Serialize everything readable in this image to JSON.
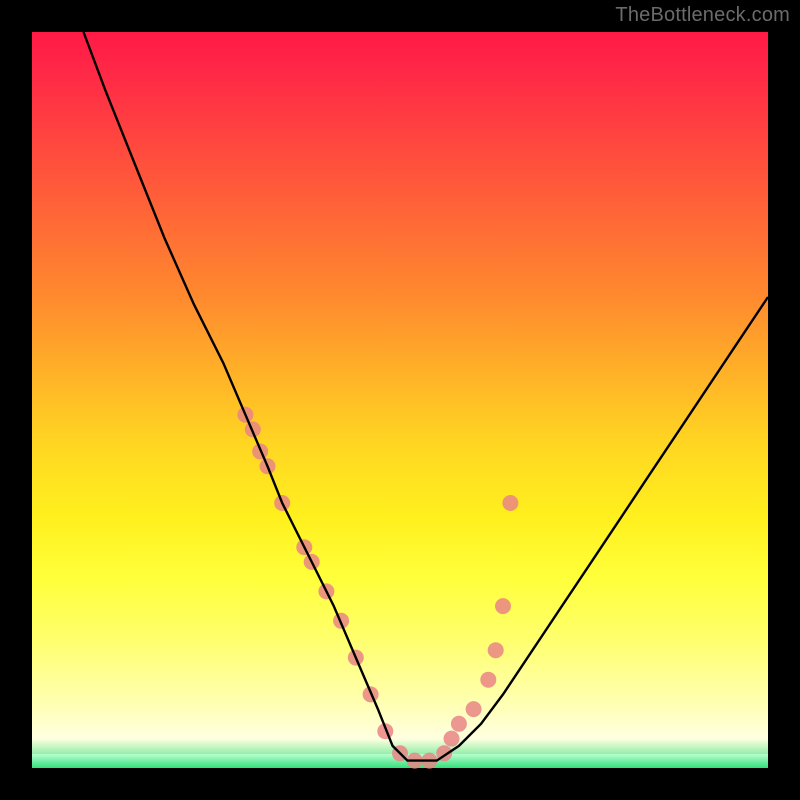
{
  "watermark": "TheBottleneck.com",
  "chart_data": {
    "type": "line",
    "title": "",
    "xlabel": "",
    "ylabel": "",
    "xlim": [
      0,
      100
    ],
    "ylim": [
      0,
      100
    ],
    "grid": false,
    "legend": false,
    "background_gradient": {
      "top": "#ff1a46",
      "mid": "#ffff3a",
      "bottom": "#33e07a"
    },
    "series": [
      {
        "name": "curve",
        "color": "#000000",
        "x": [
          7,
          10,
          14,
          18,
          22,
          26,
          29,
          32,
          34,
          38,
          41,
          44,
          47,
          49,
          51,
          55,
          58,
          61,
          64,
          68,
          72,
          76,
          80,
          84,
          88,
          92,
          96,
          100
        ],
        "y": [
          100,
          92,
          82,
          72,
          63,
          55,
          48,
          41,
          36,
          28,
          22,
          15,
          8,
          3,
          1,
          1,
          3,
          6,
          10,
          16,
          22,
          28,
          34,
          40,
          46,
          52,
          58,
          64
        ]
      }
    ],
    "markers": {
      "name": "dots",
      "color": "#e98585",
      "radius": 8,
      "x": [
        29,
        30,
        31,
        32,
        34,
        37,
        38,
        40,
        42,
        44,
        46,
        48,
        50,
        52,
        54,
        56,
        57,
        58,
        60,
        62,
        63,
        64,
        65
      ],
      "y": [
        48,
        46,
        43,
        41,
        36,
        30,
        28,
        24,
        20,
        15,
        10,
        5,
        2,
        1,
        1,
        2,
        4,
        6,
        8,
        12,
        16,
        22,
        36
      ]
    }
  }
}
